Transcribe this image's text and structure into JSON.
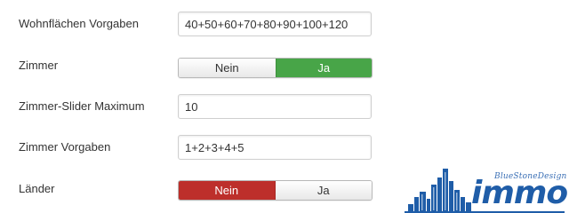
{
  "fields": {
    "wohnflaechen": {
      "label": "Wohnflächen Vorgaben",
      "value": "40+50+60+70+80+90+100+120"
    },
    "zimmer": {
      "label": "Zimmer",
      "option_no": "Nein",
      "option_yes": "Ja",
      "selected": "Ja",
      "active_color": "#48a548"
    },
    "zimmer_slider_max": {
      "label": "Zimmer-Slider Maximum",
      "value": "10"
    },
    "zimmer_vorgaben": {
      "label": "Zimmer Vorgaben",
      "value": "1+2+3+4+5"
    },
    "laender": {
      "label": "Länder",
      "option_no": "Nein",
      "option_yes": "Ja",
      "selected": "Nein",
      "active_color": "#bd2f2b"
    }
  },
  "logo": {
    "tagline": "BlueStoneDesign",
    "wordmark": "immo",
    "color": "#1f5da8"
  }
}
